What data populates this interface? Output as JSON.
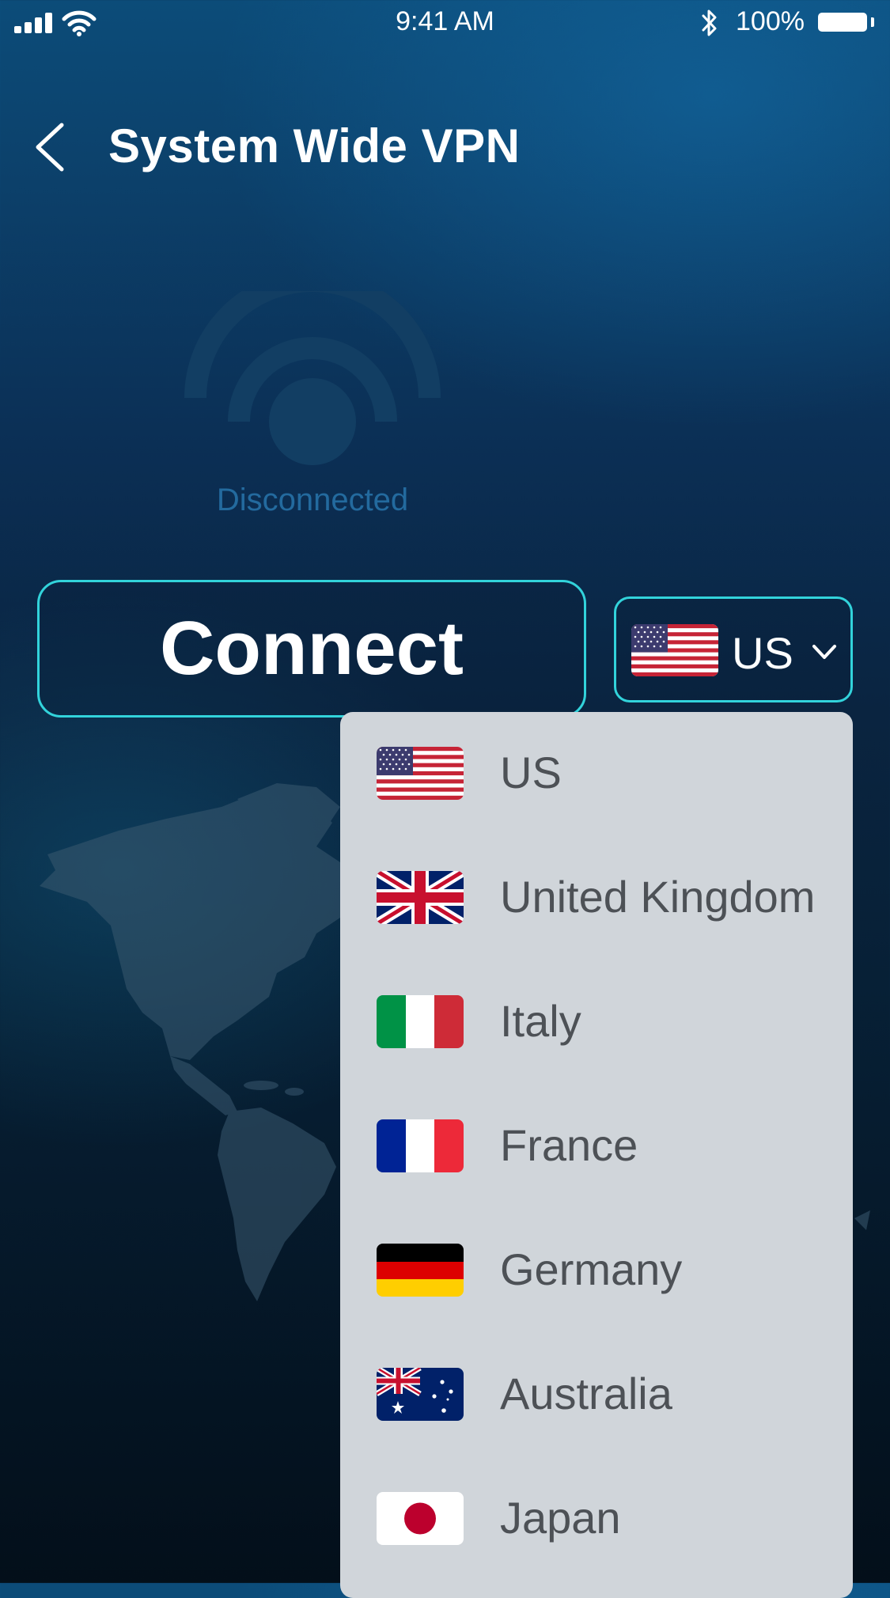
{
  "status_bar": {
    "time": "9:41 AM",
    "battery_percent": "100%",
    "battery_level": 1.0,
    "icons": [
      "cellular-signal-icon",
      "wifi-icon",
      "bluetooth-icon",
      "battery-icon"
    ]
  },
  "header": {
    "title": "System Wide VPN",
    "back_icon": "chevron-left-icon"
  },
  "connection": {
    "status": "Disconnected",
    "status_icon": "broadcast-signal-icon",
    "connect_label": "Connect"
  },
  "country_selector": {
    "selected_code": "US",
    "selected_flag": "us-flag-icon",
    "dropdown_icon": "chevron-down-icon"
  },
  "dropdown": {
    "items": [
      {
        "label": "US",
        "flag": "us-flag-icon"
      },
      {
        "label": "United Kingdom",
        "flag": "uk-flag-icon"
      },
      {
        "label": "Italy",
        "flag": "italy-flag-icon"
      },
      {
        "label": "France",
        "flag": "france-flag-icon"
      },
      {
        "label": "Germany",
        "flag": "germany-flag-icon"
      },
      {
        "label": "Australia",
        "flag": "australia-flag-icon"
      },
      {
        "label": "Japan",
        "flag": "japan-flag-icon"
      }
    ]
  },
  "colors": {
    "accent": "#32d3db",
    "status_text": "#236a9e",
    "dropdown_bg": "#d0d5da",
    "dropdown_text": "#4d5156"
  }
}
